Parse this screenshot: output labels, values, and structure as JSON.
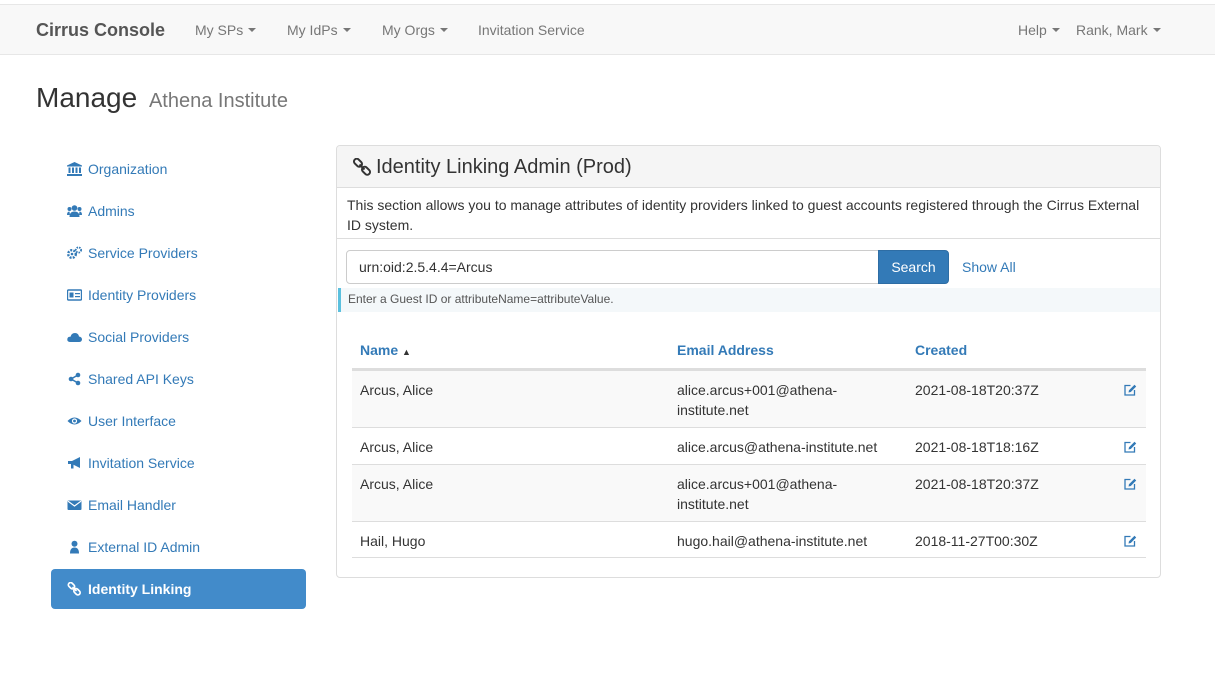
{
  "navbar": {
    "brand": "Cirrus Console",
    "items": [
      {
        "label": "My SPs"
      },
      {
        "label": "My IdPs"
      },
      {
        "label": "My Orgs"
      },
      {
        "label": "Invitation Service"
      }
    ],
    "right": [
      {
        "label": "Help"
      },
      {
        "label": "Rank, Mark"
      }
    ]
  },
  "page": {
    "title": "Manage",
    "subtitle": "Athena Institute"
  },
  "sidebar": {
    "items": [
      {
        "label": "Organization",
        "icon": "bank-icon"
      },
      {
        "label": "Admins",
        "icon": "users-icon"
      },
      {
        "label": "Service Providers",
        "icon": "cogs-icon"
      },
      {
        "label": "Identity Providers",
        "icon": "id-card-icon"
      },
      {
        "label": "Social Providers",
        "icon": "cloud-icon"
      },
      {
        "label": "Shared API Keys",
        "icon": "share-icon"
      },
      {
        "label": "User Interface",
        "icon": "eye-icon"
      },
      {
        "label": "Invitation Service",
        "icon": "bullhorn-icon"
      },
      {
        "label": "Email Handler",
        "icon": "envelope-icon"
      },
      {
        "label": "External ID Admin",
        "icon": "user-icon"
      },
      {
        "label": "Identity Linking",
        "icon": "link-icon",
        "active": true
      }
    ]
  },
  "panel": {
    "title": "Identity Linking Admin (Prod)",
    "description": "This section allows you to manage attributes of identity providers linked to guest accounts registered through the Cirrus External ID system.",
    "search": {
      "value": "urn:oid:2.5.4.4=Arcus",
      "button": "Search",
      "show_all": "Show All",
      "help": "Enter a Guest ID or attributeName=attributeValue."
    }
  },
  "table": {
    "columns": [
      "Name",
      "Email Address",
      "Created"
    ],
    "sort_indicator": "▲",
    "rows": [
      {
        "name": "Arcus, Alice",
        "email_line1": "alice.arcus+001@athena-",
        "email_line2": "institute.net",
        "created": "2021-08-18T20:37Z"
      },
      {
        "name": "Arcus, Alice",
        "email_line1": "alice.arcus@athena-institute.net",
        "email_line2": "",
        "created": "2021-08-18T18:16Z"
      },
      {
        "name": "Arcus, Alice",
        "email_line1": "alice.arcus+001@athena-",
        "email_line2": "institute.net",
        "created": "2021-08-18T20:37Z"
      },
      {
        "name": "Hail, Hugo",
        "email_line1": "hugo.hail@athena-institute.net",
        "email_line2": "",
        "created": "2018-11-27T00:30Z"
      }
    ]
  },
  "colors": {
    "link": "#337ab7",
    "active_bg": "#428bca",
    "navbar_bg": "#f8f8f8",
    "help_border": "#5bc0de"
  }
}
